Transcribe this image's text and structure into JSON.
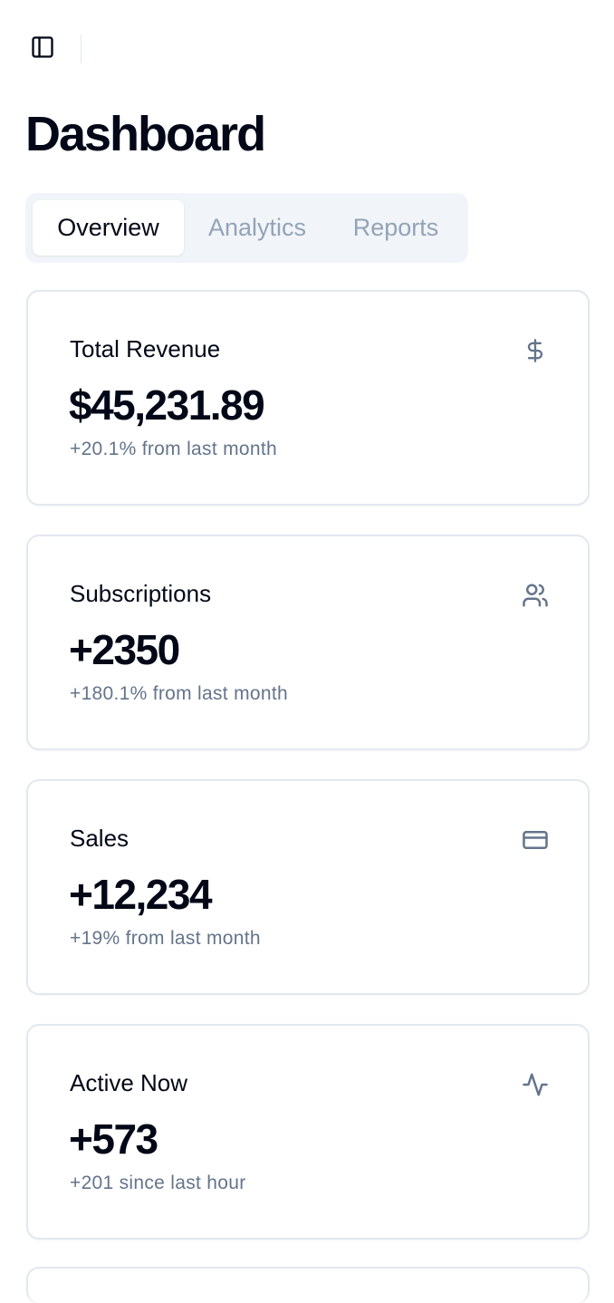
{
  "page": {
    "title": "Dashboard"
  },
  "tabs": [
    {
      "label": "Overview",
      "active": true
    },
    {
      "label": "Analytics",
      "active": false
    },
    {
      "label": "Reports",
      "active": false
    }
  ],
  "cards": [
    {
      "title": "Total Revenue",
      "value": "$45,231.89",
      "sub": "+20.1% from last month",
      "icon": "dollar-icon"
    },
    {
      "title": "Subscriptions",
      "value": "+2350",
      "sub": "+180.1% from last month",
      "icon": "users-icon"
    },
    {
      "title": "Sales",
      "value": "+12,234",
      "sub": "+19% from last month",
      "icon": "credit-card-icon"
    },
    {
      "title": "Active Now",
      "value": "+573",
      "sub": "+201 since last hour",
      "icon": "activity-icon"
    }
  ],
  "colors": {
    "text_primary": "#020817",
    "text_muted": "#64748b",
    "tab_inactive": "#94a3b8",
    "tab_bg": "#f1f5f9",
    "border": "#e2e8f0"
  }
}
